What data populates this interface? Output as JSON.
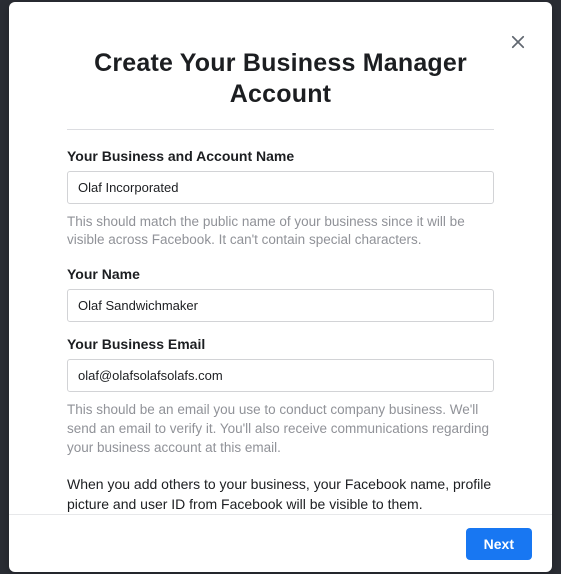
{
  "modal": {
    "title": "Create Your Business Manager Account"
  },
  "fields": {
    "businessName": {
      "label": "Your Business and Account Name",
      "value": "Olaf Incorporated",
      "help": "This should match the public name of your business since it will be visible across Facebook. It can't contain special characters."
    },
    "yourName": {
      "label": "Your Name",
      "value": "Olaf Sandwichmaker"
    },
    "businessEmail": {
      "label": "Your Business Email",
      "value": "olaf@olafsolafsolafs.com",
      "help": "This should be an email you use to conduct company business. We'll send an email to verify it. You'll also receive communications regarding your business account at this email."
    }
  },
  "note": "When you add others to your business, your Facebook name, profile picture and user ID from Facebook will be visible to them.",
  "footer": {
    "next_label": "Next"
  }
}
